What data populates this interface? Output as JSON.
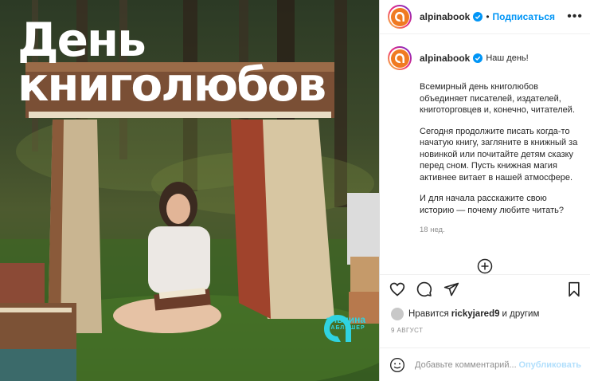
{
  "post_image": {
    "headline_line1": "День",
    "headline_line2": "книголюбов",
    "brand_name": "альпина",
    "brand_sub": "ПАБЛИШЕР",
    "brand_color": "#2fd3e0"
  },
  "header": {
    "username": "alpinabook",
    "separator": "•",
    "follow_label": "Подписаться",
    "more_icon": "more-horizontal-icon"
  },
  "caption": {
    "username": "alpinabook",
    "lead": "Наш день!",
    "para1": "Всемирный день книголюбов объединяет писателей, издателей, книготорговцев и, конечно, читателей.",
    "para2": "Сегодня продолжите писать когда-то начатую книгу, загляните в книжный за новинкой или почитайте детям сказку перед сном. Пусть книжная магия активнее витает в нашей атмосфере.",
    "para3": "И для начала расскажите свою историю — почему любите читать?",
    "time": "18 нед."
  },
  "actions": {
    "icons": [
      "heart-icon",
      "comment-icon",
      "share-icon",
      "bookmark-icon"
    ]
  },
  "likes": {
    "prefix": "Нравится",
    "user": "rickyjared9",
    "suffix": "и другим"
  },
  "date": "9 АВГУСТ",
  "comment_box": {
    "placeholder": "Добавьте комментарий...",
    "publish_label": "Опубликовать"
  },
  "colors": {
    "accent": "#0095f6",
    "brand_orange": "#f07a22",
    "muted": "#8e8e8e"
  }
}
